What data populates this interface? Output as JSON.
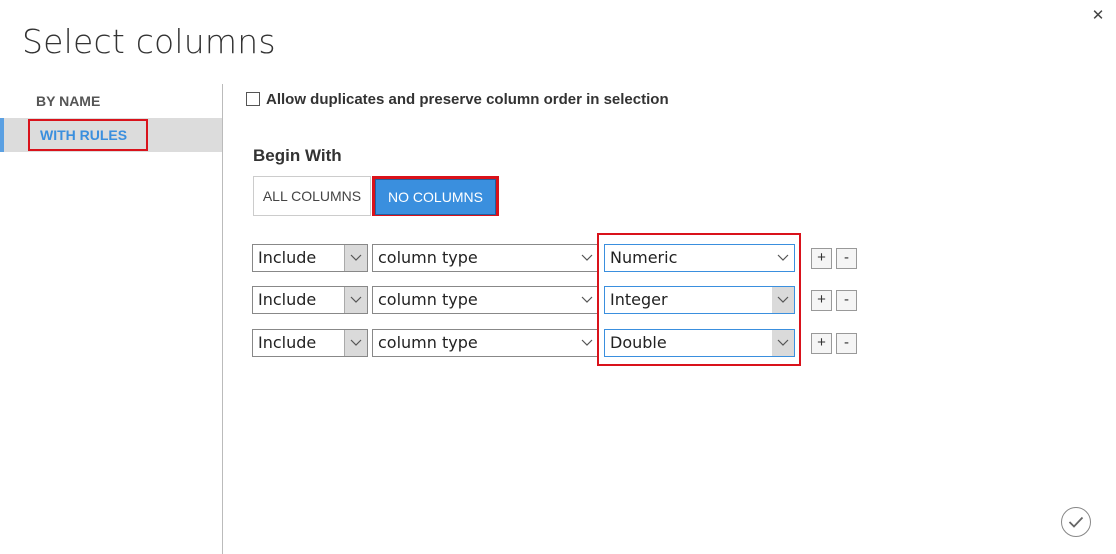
{
  "dialog": {
    "title": "Select columns",
    "close_icon": "close-icon"
  },
  "sidebar": {
    "items": [
      {
        "label": "BY NAME",
        "selected": false
      },
      {
        "label": "WITH RULES",
        "selected": true
      }
    ]
  },
  "options": {
    "allow_duplicates_label": "Allow duplicates and preserve column order in selection",
    "allow_duplicates_checked": false
  },
  "begin_with": {
    "title": "Begin With",
    "all_columns": "ALL COLUMNS",
    "no_columns": "NO COLUMNS",
    "selected": "NO COLUMNS"
  },
  "rules": [
    {
      "action": "Include",
      "criterion": "column type",
      "value": "Numeric"
    },
    {
      "action": "Include",
      "criterion": "column type",
      "value": "Integer"
    },
    {
      "action": "Include",
      "criterion": "column type",
      "value": "Double"
    }
  ],
  "buttons": {
    "plus": "+",
    "minus": "-",
    "confirm_icon": "checkmark-icon"
  },
  "colors": {
    "accent": "#3a8fde",
    "highlight": "#d9121b"
  }
}
